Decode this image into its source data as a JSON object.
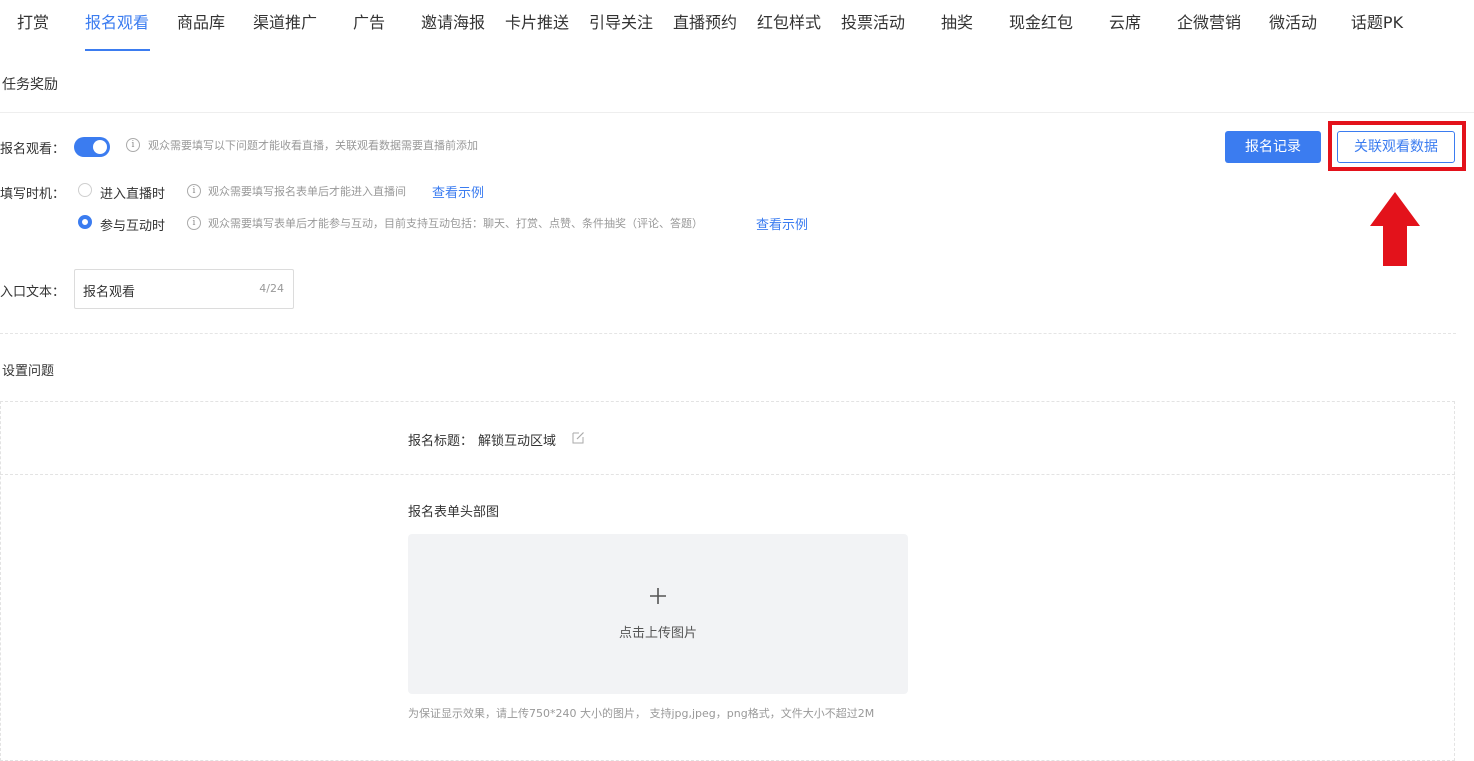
{
  "tabs": [
    {
      "label": "打赏"
    },
    {
      "label": "报名观看"
    },
    {
      "label": "商品库"
    },
    {
      "label": "渠道推广"
    },
    {
      "label": "广告"
    },
    {
      "label": "邀请海报"
    },
    {
      "label": "卡片推送"
    },
    {
      "label": "引导关注"
    },
    {
      "label": "直播预约"
    },
    {
      "label": "红包样式"
    },
    {
      "label": "投票活动"
    },
    {
      "label": "抽奖"
    },
    {
      "label": "现金红包"
    },
    {
      "label": "云席"
    },
    {
      "label": "企微营销"
    },
    {
      "label": "微活动"
    },
    {
      "label": "话题PK"
    }
  ],
  "section": {
    "title": "任务奖励"
  },
  "register": {
    "label": "报名观看：",
    "enabled": true,
    "hint": "观众需要填写以下问题才能收看直播，关联观看数据需要直播前添加",
    "records_button": "报名记录",
    "link_data_button": "关联观看数据"
  },
  "timing": {
    "label": "填写时机：",
    "options": [
      {
        "label": "进入直播时",
        "selected": false,
        "hint": "观众需要填写报名表单后才能进入直播间",
        "link": "查看示例"
      },
      {
        "label": "参与互动时",
        "selected": true,
        "hint": "观众需要填写表单后才能参与互动，目前支持互动包括：聊天、打赏、点赞、条件抽奖（评论、答题）",
        "link": "查看示例"
      }
    ]
  },
  "entry": {
    "label": "入口文本：",
    "value": "报名观看",
    "count": "4/24"
  },
  "questions": {
    "title": "设置问题"
  },
  "form": {
    "title_label": "报名标题：",
    "title_value": "解锁互动区域",
    "header_image_label": "报名表单头部图",
    "upload_text": "点击上传图片",
    "upload_hint": "为保证显示效果，请上传750*240 大小的图片， 支持jpg,jpeg，png格式，文件大小不超过2M"
  },
  "colors": {
    "accent": "#3b7cf0",
    "highlight": "#e3121b"
  }
}
